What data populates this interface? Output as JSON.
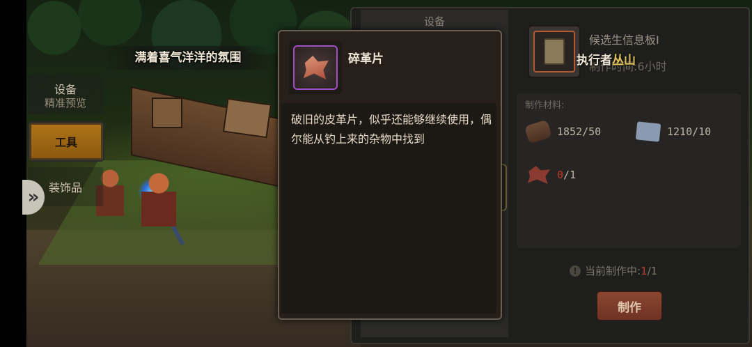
{
  "scene": {
    "banner_text": "满着喜气洋洋的氛围"
  },
  "left_tabs": {
    "devices_label": "设备",
    "devices_sub": "精准预览",
    "tools_label": "工具",
    "decor_label": "装饰品",
    "arrow_icon": "double-chevron-right-icon"
  },
  "panel": {
    "mid_title": "设备",
    "candidate_title": "候选生信息板I",
    "candidate_time": "制作时间:6小时",
    "executor_prefix": "执行者",
    "executor_name": "丛山",
    "materials_label": "制作材料:",
    "materials": [
      {
        "icon": "log-icon",
        "have": "1852",
        "need": "50"
      },
      {
        "icon": "paper-scroll-icon",
        "have": "1210",
        "need": "10"
      },
      {
        "icon": "leather-scrap-icon",
        "have": "0",
        "need": "1"
      }
    ],
    "current_label": "当前制作中:",
    "current_count": "1",
    "current_max": "1",
    "craft_button": "制作"
  },
  "tooltip": {
    "item_name": "碎革片",
    "item_icon": "leather-scrap-icon",
    "description": "破旧的皮革片，似乎还能够继续使用，偶尔能从钓上来的杂物中找到"
  },
  "colors": {
    "accent_gold": "#b07418",
    "rare_purple": "#a34fc9",
    "warning_red": "#c03a2e",
    "executor_name": "#e2c45c"
  }
}
